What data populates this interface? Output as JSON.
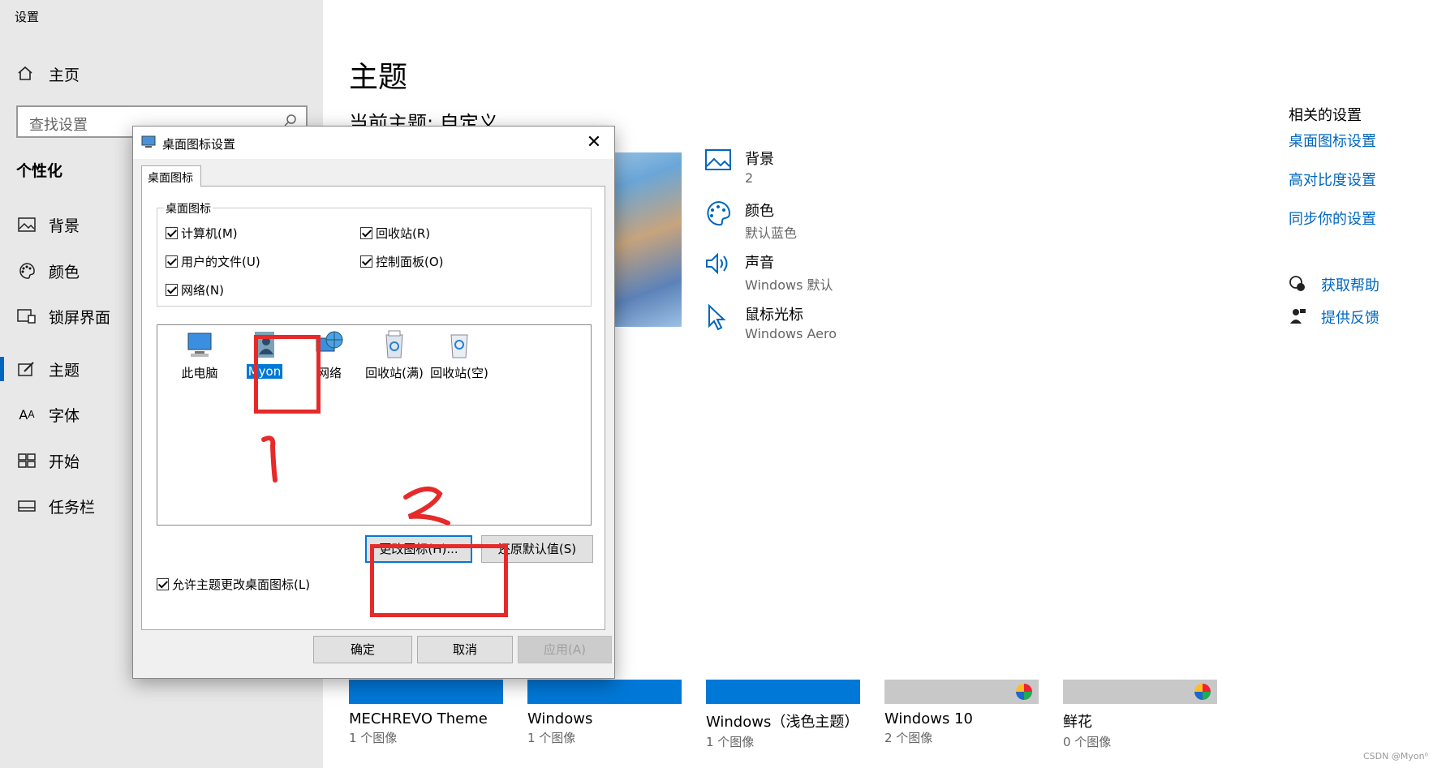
{
  "window": {
    "title": "设置"
  },
  "nav": {
    "home": "主页",
    "search_placeholder": "查找设置",
    "section": "个性化",
    "items": [
      {
        "label": "背景",
        "icon": "image-icon"
      },
      {
        "label": "颜色",
        "icon": "palette-icon"
      },
      {
        "label": "锁屏界面",
        "icon": "lockscreen-icon"
      },
      {
        "label": "主题",
        "icon": "theme-brush-icon",
        "active": true
      },
      {
        "label": "字体",
        "icon": "font-icon"
      },
      {
        "label": "开始",
        "icon": "start-icon"
      },
      {
        "label": "任务栏",
        "icon": "taskbar-icon"
      }
    ]
  },
  "main": {
    "title": "主题",
    "current_theme": "当前主题: 自定义",
    "props": [
      {
        "name": "背景",
        "value": "2",
        "icon": "image-icon"
      },
      {
        "name": "颜色",
        "value": "默认蓝色",
        "icon": "palette-icon"
      },
      {
        "name": "声音",
        "value": "Windows 默认",
        "icon": "speaker-icon"
      },
      {
        "name": "鼠标光标",
        "value": "Windows Aero",
        "icon": "cursor-icon"
      }
    ],
    "themes": [
      {
        "name": "MECHREVO Theme",
        "count": "1 个图像",
        "color": "#0078d7"
      },
      {
        "name": "Windows",
        "count": "1 个图像",
        "color": "#0078d7"
      },
      {
        "name": "Windows（浅色主题）",
        "count": "1 个图像",
        "color": "#0078d7"
      },
      {
        "name": "Windows 10",
        "count": "2 个图像",
        "color": "#c8c8c8"
      },
      {
        "name": "鲜花",
        "count": "0 个图像",
        "color": "#c8c8c8"
      }
    ]
  },
  "related": {
    "heading": "相关的设置",
    "links": [
      "桌面图标设置",
      "高对比度设置",
      "同步你的设置"
    ],
    "help": "获取帮助",
    "feedback": "提供反馈"
  },
  "dialog": {
    "title": "桌面图标设置",
    "tab": "桌面图标",
    "group_label": "桌面图标",
    "checkboxes": [
      {
        "label": "计算机(M)",
        "checked": true
      },
      {
        "label": "回收站(R)",
        "checked": true
      },
      {
        "label": "用户的文件(U)",
        "checked": true
      },
      {
        "label": "控制面板(O)",
        "checked": true
      },
      {
        "label": "网络(N)",
        "checked": true
      }
    ],
    "icons": [
      {
        "label": "此电脑",
        "icon": "computer-icon"
      },
      {
        "label": "Myon",
        "icon": "user-folder-icon",
        "selected": true
      },
      {
        "label": "网络",
        "icon": "network-icon"
      },
      {
        "label": "回收站(满)",
        "icon": "recycle-bin-full-icon"
      },
      {
        "label": "回收站(空)",
        "icon": "recycle-bin-empty-icon"
      }
    ],
    "change_icon": "更改图标(H)...",
    "restore_default": "还原默认值(S)",
    "allow_themes": "允许主题更改桌面图标(L)",
    "ok": "确定",
    "cancel": "取消",
    "apply": "应用(A)"
  },
  "annotations": {
    "mark1": "1",
    "mark2": "2",
    "color": "#e62a2a"
  },
  "watermark": "CSDN @Myon⁰"
}
